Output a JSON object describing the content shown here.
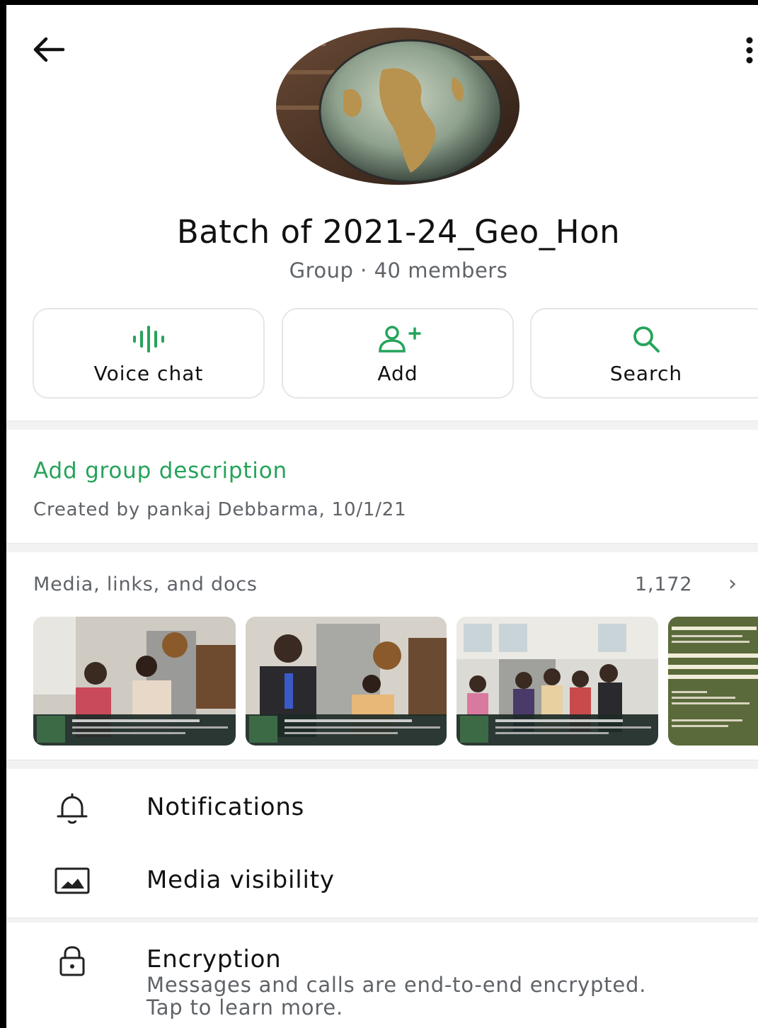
{
  "group": {
    "name": "Batch of 2021-24_Geo_Hon",
    "subtitle": "Group · 40 members"
  },
  "actions": [
    {
      "label": "Voice chat",
      "icon": "voice-wave-icon"
    },
    {
      "label": "Add",
      "icon": "add-person-icon"
    },
    {
      "label": "Search",
      "icon": "search-icon"
    }
  ],
  "description": {
    "link": "Add group description",
    "created": "Created by pankaj Debbarma, 10/1/21"
  },
  "media": {
    "title": "Media, links, and docs",
    "count": "1,172"
  },
  "settings": {
    "notifications": "Notifications",
    "media_visibility": "Media visibility",
    "encryption": "Encryption",
    "encryption_sub": "Messages and calls are end-to-end encrypted. Tap to learn more."
  },
  "colors": {
    "accent": "#25a35a",
    "text": "#111111",
    "secondary": "#5f6368"
  }
}
